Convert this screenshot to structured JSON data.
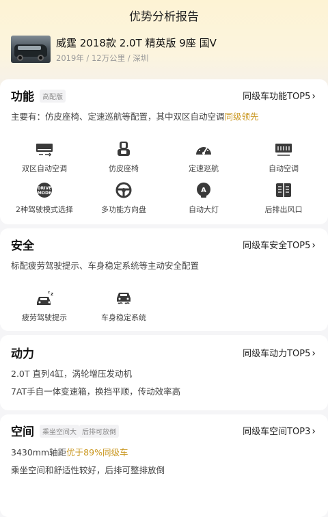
{
  "header": {
    "title": "优势分析报告"
  },
  "car": {
    "name": "威霆 2018款 2.0T 精英版 9座 国V",
    "meta": "2019年 / 12万公里 / 深圳"
  },
  "sections": {
    "function": {
      "title": "功能",
      "tag": "高配版",
      "rank": "同级车功能TOP5",
      "desc_prefix": "主要有：仿皮座椅、定速巡航等配置，其中双区自动空调",
      "desc_highlight": "同级领先",
      "features": [
        {
          "label": "双区自动空调",
          "icon": "dual-ac-icon"
        },
        {
          "label": "仿皮座椅",
          "icon": "seat-icon"
        },
        {
          "label": "定速巡航",
          "icon": "cruise-icon"
        },
        {
          "label": "自动空调",
          "icon": "auto-ac-icon"
        },
        {
          "label": "2种驾驶模式选择",
          "icon": "drive-mode-icon",
          "badge_line1": "DRIVE",
          "badge_line2": "MODE"
        },
        {
          "label": "多功能方向盘",
          "icon": "steering-wheel-icon"
        },
        {
          "label": "自动大灯",
          "icon": "headlight-icon",
          "badge": "A"
        },
        {
          "label": "后排出风口",
          "icon": "rear-vent-icon"
        }
      ]
    },
    "safety": {
      "title": "安全",
      "rank": "同级车安全TOP5",
      "desc": "标配疲劳驾驶提示、车身稳定系统等主动安全配置",
      "features": [
        {
          "label": "疲劳驾驶提示",
          "icon": "fatigue-alert-icon"
        },
        {
          "label": "车身稳定系统",
          "icon": "stability-control-icon"
        }
      ]
    },
    "power": {
      "title": "动力",
      "rank": "同级车动力TOP5",
      "line1": "2.0T 直列4缸，涡轮增压发动机",
      "line2": "7AT手自一体变速箱，换挡平顺，传动效率高"
    },
    "space": {
      "title": "空间",
      "tags": [
        "乘坐空间大",
        "后排可放倒"
      ],
      "rank": "同级车空间TOP3",
      "line1_prefix": "3430mm轴距",
      "line1_highlight": "优于89%同级车",
      "line2": "乘坐空间和舒适性较好，后排可整排放倒"
    }
  },
  "colors": {
    "highlight": "#c9961e",
    "icon": "#3a3a3a"
  }
}
